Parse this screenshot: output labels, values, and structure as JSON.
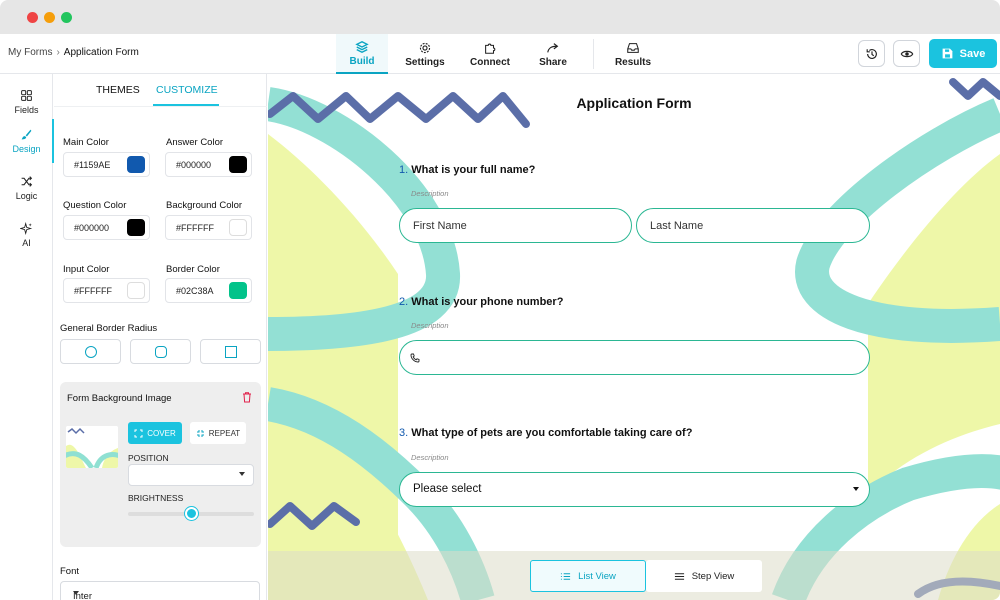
{
  "colors": {
    "accent": "#1bc3df",
    "main": "#1159AE",
    "border": "#02C38A"
  },
  "breadcrumb": {
    "parent": "My Forms",
    "separator": "›",
    "current": "Application Form"
  },
  "nav": {
    "tabs": [
      {
        "label": "Build",
        "icon": "layers-icon"
      },
      {
        "label": "Settings",
        "icon": "gear-icon"
      },
      {
        "label": "Connect",
        "icon": "puzzle-icon"
      },
      {
        "label": "Share",
        "icon": "share-arrow-icon"
      },
      {
        "label": "Results",
        "icon": "inbox-icon"
      }
    ],
    "save_label": "Save"
  },
  "rail": {
    "items": [
      {
        "label": "Fields",
        "icon": "grid-icon"
      },
      {
        "label": "Design",
        "icon": "brush-icon"
      },
      {
        "label": "Logic",
        "icon": "shuffle-icon"
      },
      {
        "label": "AI",
        "icon": "sparkle-icon"
      }
    ]
  },
  "panel": {
    "tabs": [
      "THEMES",
      "CUSTOMIZE"
    ],
    "colors": [
      {
        "label": "Main Color",
        "value": "#1159AE"
      },
      {
        "label": "Answer Color",
        "value": "#000000"
      },
      {
        "label": "Question Color",
        "value": "#000000"
      },
      {
        "label": "Background Color",
        "value": "#FFFFFF"
      },
      {
        "label": "Input Color",
        "value": "#FFFFFF"
      },
      {
        "label": "Border Color",
        "value": "#02C38A"
      }
    ],
    "radius_label": "General Border Radius",
    "bg_image": {
      "title": "Form Background Image",
      "cover_label": "COVER",
      "repeat_label": "REPEAT",
      "position_label": "POSITION",
      "position_value": "",
      "brightness_label": "BRIGHTNESS",
      "brightness": 0.5
    },
    "font_label": "Font",
    "font_value": "Inter"
  },
  "form": {
    "title": "Application Form",
    "questions": [
      {
        "num": "1.",
        "text": "What is your full name?",
        "description": "Description",
        "first_placeholder": "First Name",
        "last_placeholder": "Last Name"
      },
      {
        "num": "2.",
        "text": "What is your phone number?",
        "description": "Description",
        "icon": "phone-icon"
      },
      {
        "num": "3.",
        "text": "What type of pets are you comfortable taking care of?",
        "description": "Description",
        "select_value": "Please select"
      }
    ]
  },
  "views": {
    "list_label": "List View",
    "step_label": "Step View"
  }
}
